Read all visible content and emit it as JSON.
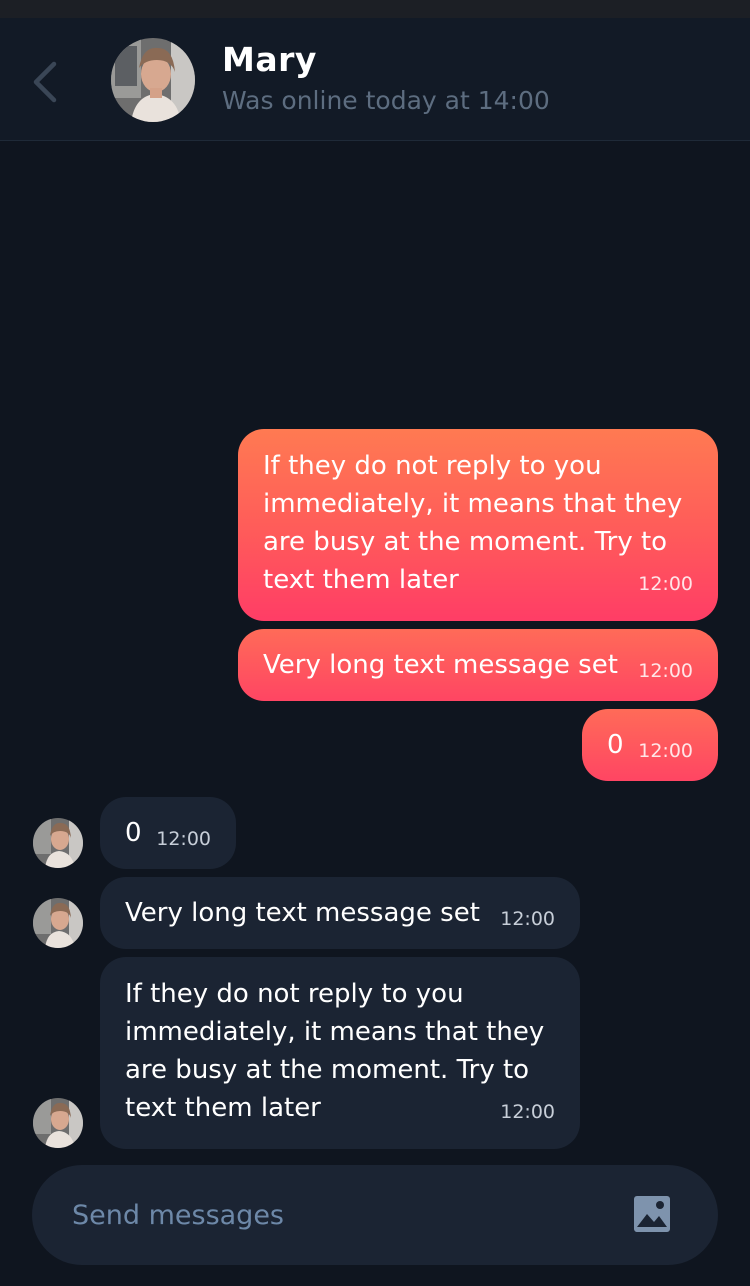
{
  "header": {
    "name": "Mary",
    "status": "Was online today at 14:00"
  },
  "messages": {
    "out_long": {
      "text": "If they do not reply to you immediately, it means that they are busy at the moment. Try to text them later",
      "time": "12:00"
    },
    "out_medium": {
      "text": "Very long text message set",
      "time": "12:00"
    },
    "out_short": {
      "text": "0",
      "time": "12:00"
    },
    "in_short": {
      "text": "0",
      "time": "12:00"
    },
    "in_medium": {
      "text": "Very long text message set",
      "time": "12:00"
    },
    "in_long": {
      "text": "If they do not reply to you immediately, it means that they are busy at the moment. Try to text them later",
      "time": "12:00"
    }
  },
  "composer": {
    "placeholder": "Send messages"
  },
  "colors": {
    "background": "#0f151f",
    "header": "#121a26",
    "incoming_bubble": "#1b2433",
    "outgoing_top": "#ff7a52",
    "outgoing_bottom": "#ff3d66",
    "placeholder": "#6d88a8"
  },
  "icons": {
    "back": "chevron-left-icon",
    "image": "image-icon"
  }
}
